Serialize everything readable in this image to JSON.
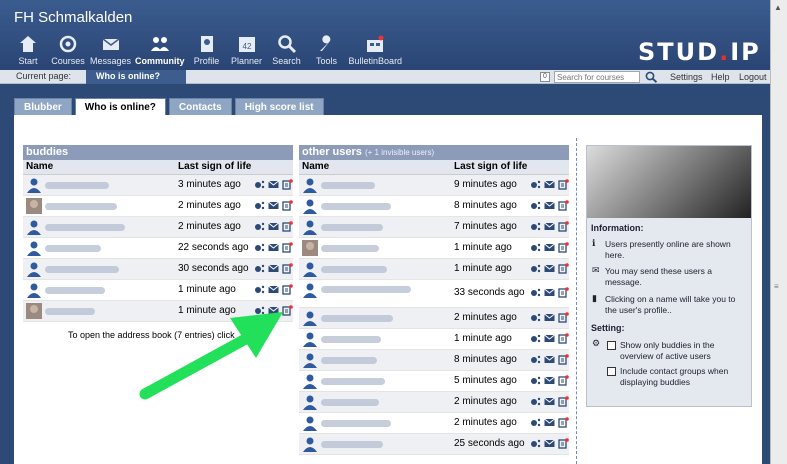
{
  "site_name": "FH Schmalkalden",
  "nav": [
    {
      "label": "Start",
      "icon": "home-icon"
    },
    {
      "label": "Courses",
      "icon": "courses-icon"
    },
    {
      "label": "Messages",
      "icon": "mail-icon"
    },
    {
      "label": "Community",
      "icon": "community-icon",
      "active": true
    },
    {
      "label": "Profile",
      "icon": "profile-icon"
    },
    {
      "label": "Planner",
      "icon": "calendar-icon"
    },
    {
      "label": "Search",
      "icon": "search-icon"
    },
    {
      "label": "Tools",
      "icon": "wrench-icon"
    },
    {
      "label": "BulletinBoard",
      "icon": "bulletin-icon"
    }
  ],
  "logo": {
    "main": "STUD",
    "dot": ".",
    "tail": "IP"
  },
  "breadcrumb": {
    "label": "Current page:",
    "current": "Who is online?"
  },
  "search": {
    "badge": "0",
    "placeholder": "Search for courses"
  },
  "toplinks": {
    "settings": "Settings",
    "help": "Help",
    "logout": "Logout"
  },
  "tabs": [
    {
      "label": "Blubber"
    },
    {
      "label": "Who is online?",
      "active": true
    },
    {
      "label": "Contacts"
    },
    {
      "label": "High score list"
    }
  ],
  "buddies": {
    "title": "buddies",
    "col_name": "Name",
    "col_time": "Last sign of life",
    "rows": [
      {
        "time": "3 minutes ago",
        "w": 64
      },
      {
        "time": "2 minutes ago",
        "w": 72,
        "photo": true
      },
      {
        "time": "2 minutes ago",
        "w": 80
      },
      {
        "time": "22 seconds ago",
        "w": 56
      },
      {
        "time": "30 seconds ago",
        "w": 74
      },
      {
        "time": "1 minute ago",
        "w": 60
      },
      {
        "time": "1 minute ago",
        "w": 50,
        "photo": true
      }
    ],
    "note": "To open the address book (7 entries) click"
  },
  "others": {
    "title": "other users",
    "subtitle": "(+ 1 invisible users)",
    "col_name": "Name",
    "col_time": "Last sign of life",
    "rows": [
      {
        "time": "9 minutes ago",
        "w": 54
      },
      {
        "time": "8 minutes ago",
        "w": 70
      },
      {
        "time": "7 minutes ago",
        "w": 62
      },
      {
        "time": "1 minute ago",
        "w": 58,
        "photo": true
      },
      {
        "time": "1 minute ago",
        "w": 66
      },
      {
        "time": "33 seconds ago",
        "w": 90,
        "tall": true
      },
      {
        "time": "2 minutes ago",
        "w": 72
      },
      {
        "time": "1 minute ago",
        "w": 60
      },
      {
        "time": "8 minutes ago",
        "w": 56
      },
      {
        "time": "5 minutes ago",
        "w": 64
      },
      {
        "time": "2 minutes ago",
        "w": 58
      },
      {
        "time": "2 minutes ago",
        "w": 70
      },
      {
        "time": "25 seconds ago",
        "w": 62
      }
    ]
  },
  "info": {
    "info_title": "Information:",
    "line1": "Users presently online are shown here.",
    "line2": "You may send these users a message.",
    "line3": "Clicking on a name will take you to the user's profile..",
    "setting_title": "Setting:",
    "opt1": "Show only buddies in the overview of active users",
    "opt2": "Include contact groups when displaying buddies"
  },
  "colors": {
    "accent": "#2d4a77",
    "arrow": "#22e05a"
  }
}
